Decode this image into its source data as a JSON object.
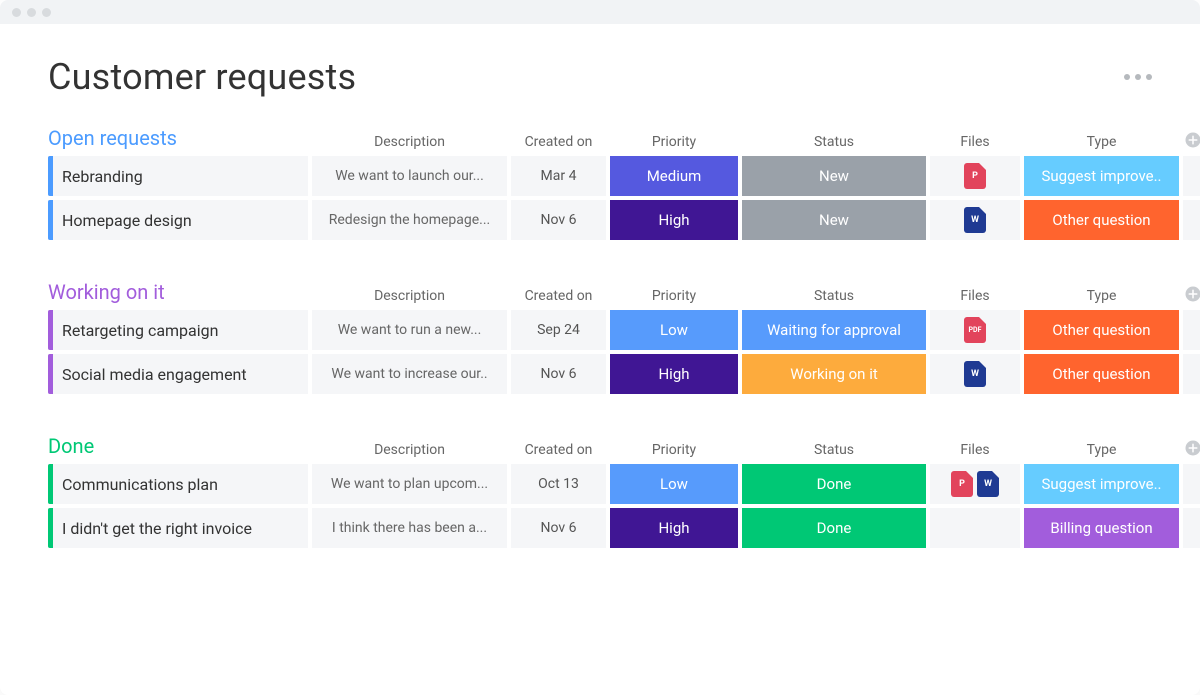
{
  "page": {
    "title": "Customer requests"
  },
  "columns": {
    "description": "Description",
    "created": "Created on",
    "priority": "Priority",
    "status": "Status",
    "files": "Files",
    "type": "Type"
  },
  "groups": [
    {
      "title": "Open requests",
      "color": "blue",
      "rows": [
        {
          "name": "Rebranding",
          "description": "We want to launch our...",
          "created": "Mar 4",
          "priority": {
            "label": "Medium",
            "class": "pill-medium"
          },
          "status": {
            "label": "New",
            "class": "pill-new"
          },
          "files": [
            "p"
          ],
          "type": {
            "label": "Suggest improve..",
            "class": "type-suggest"
          }
        },
        {
          "name": "Homepage design",
          "description": "Redesign the homepage...",
          "created": "Nov 6",
          "priority": {
            "label": "High",
            "class": "pill-high"
          },
          "status": {
            "label": "New",
            "class": "pill-new"
          },
          "files": [
            "w"
          ],
          "type": {
            "label": "Other question",
            "class": "type-other"
          }
        }
      ]
    },
    {
      "title": "Working on it",
      "color": "purple",
      "rows": [
        {
          "name": "Retargeting campaign",
          "description": "We want to run a new...",
          "created": "Sep 24",
          "priority": {
            "label": "Low",
            "class": "pill-low"
          },
          "status": {
            "label": "Waiting for approval",
            "class": "pill-wait"
          },
          "files": [
            "pdf"
          ],
          "type": {
            "label": "Other question",
            "class": "type-other"
          }
        },
        {
          "name": "Social media engagement",
          "description": "We want to increase our..",
          "created": "Nov 6",
          "priority": {
            "label": "High",
            "class": "pill-high"
          },
          "status": {
            "label": "Working on it",
            "class": "pill-working"
          },
          "files": [
            "w"
          ],
          "type": {
            "label": "Other question",
            "class": "type-other"
          }
        }
      ]
    },
    {
      "title": "Done",
      "color": "green",
      "rows": [
        {
          "name": "Communications plan",
          "description": "We want to plan upcom...",
          "created": "Oct 13",
          "priority": {
            "label": "Low",
            "class": "pill-low"
          },
          "status": {
            "label": "Done",
            "class": "pill-done"
          },
          "files": [
            "p",
            "w"
          ],
          "type": {
            "label": "Suggest improve..",
            "class": "type-suggest"
          }
        },
        {
          "name": "I didn't get the right invoice",
          "description": "I think there has been a...",
          "created": "Nov 6",
          "priority": {
            "label": "High",
            "class": "pill-high"
          },
          "status": {
            "label": "Done",
            "class": "pill-done"
          },
          "files": [],
          "type": {
            "label": "Billing question",
            "class": "type-billing"
          }
        }
      ]
    }
  ]
}
